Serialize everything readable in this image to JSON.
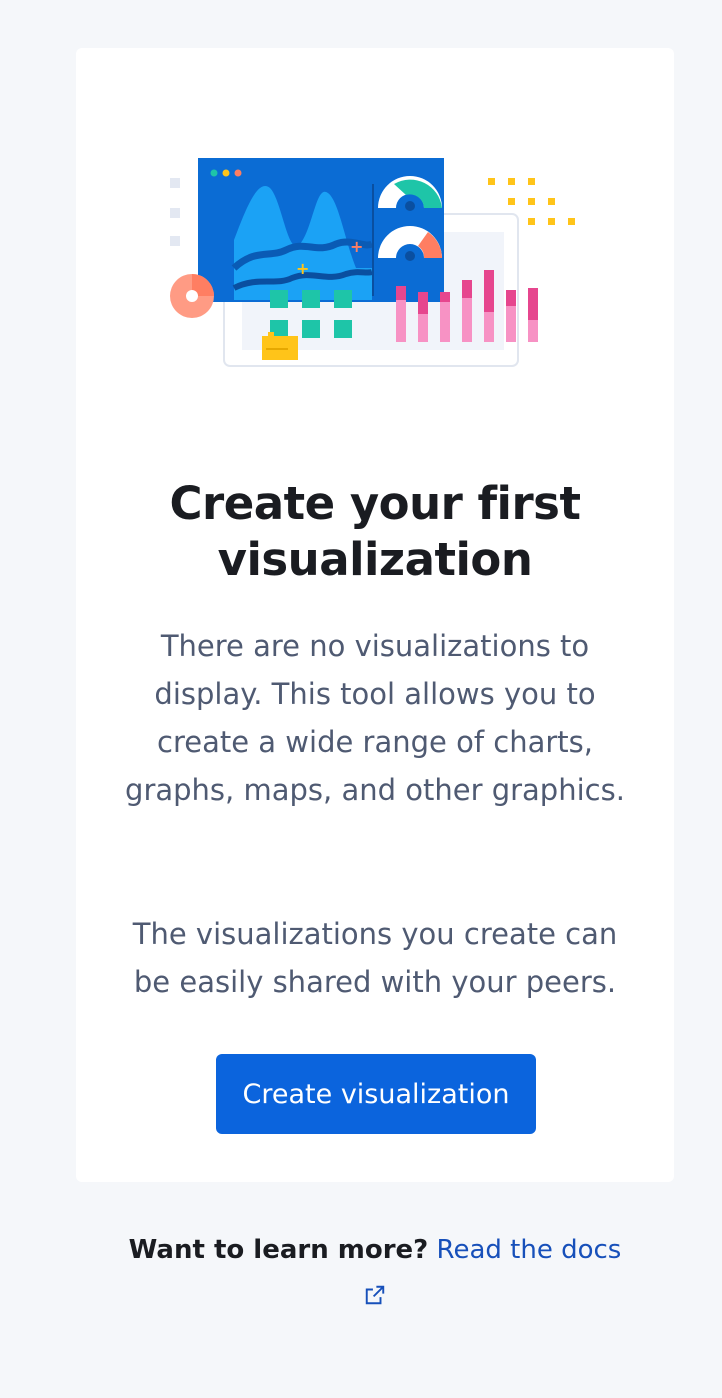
{
  "empty_state": {
    "illustration_icon": "dashboard-visualization-illustration",
    "title_line1": "Create your first",
    "title_line2": "visualization",
    "body_paragraph_1": "There are no visualizations to display. This tool allows you to create a wide range of charts, graphs, maps, and other graphics.",
    "body_paragraph_2": "The visualizations you create can be easily shared with your peers.",
    "primary_button_label": "Create visualization"
  },
  "footer": {
    "question": "Want to learn more?",
    "docs_link_label": "Read the docs",
    "external_icon": "external-link-icon"
  },
  "colors": {
    "page_background": "#f5f7fa",
    "card_background": "#ffffff",
    "primary_button": "#0b64dd",
    "link": "#1750ba",
    "title": "#1a1c21",
    "body_text": "#4f5a72"
  }
}
